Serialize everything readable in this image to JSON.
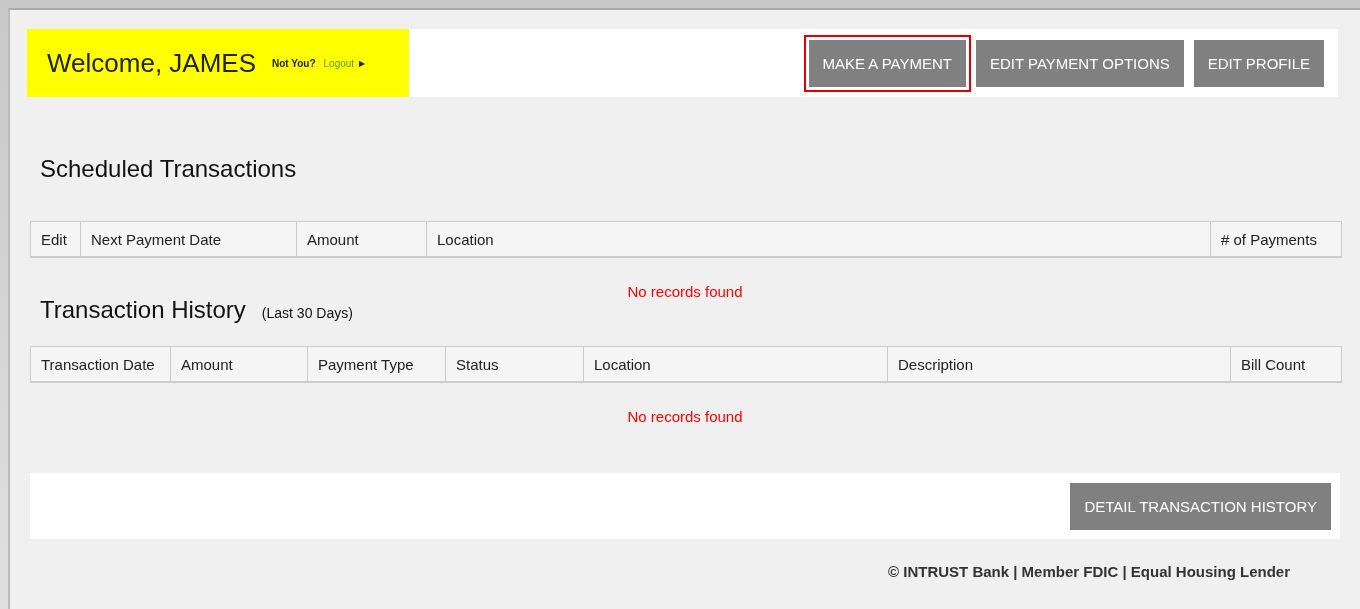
{
  "header": {
    "welcome": "Welcome, JAMES",
    "not_you": "Not You?",
    "logout": "Logout",
    "logout_arrow": "▶"
  },
  "nav_buttons": [
    {
      "label": "MAKE A PAYMENT",
      "highlighted": true
    },
    {
      "label": "EDIT PAYMENT OPTIONS",
      "highlighted": false
    },
    {
      "label": "EDIT PROFILE",
      "highlighted": false
    }
  ],
  "sections": [
    {
      "title": "Scheduled Transactions",
      "columns": [
        "Edit",
        "Next Payment Date",
        "Amount",
        "Location",
        "# of Payments"
      ],
      "empty_message": "No records found"
    },
    {
      "title": "Transaction History",
      "subtitle": "(Last 30 Days)",
      "columns": [
        "Transaction Date",
        "Amount",
        "Payment Type",
        "Status",
        "Location",
        "Description",
        "Bill Count"
      ],
      "empty_message": "No records found"
    }
  ],
  "footer_button": "DETAIL TRANSACTION HISTORY",
  "footer_text": "© INTRUST Bank | Member FDIC | Equal Housing Lender"
}
